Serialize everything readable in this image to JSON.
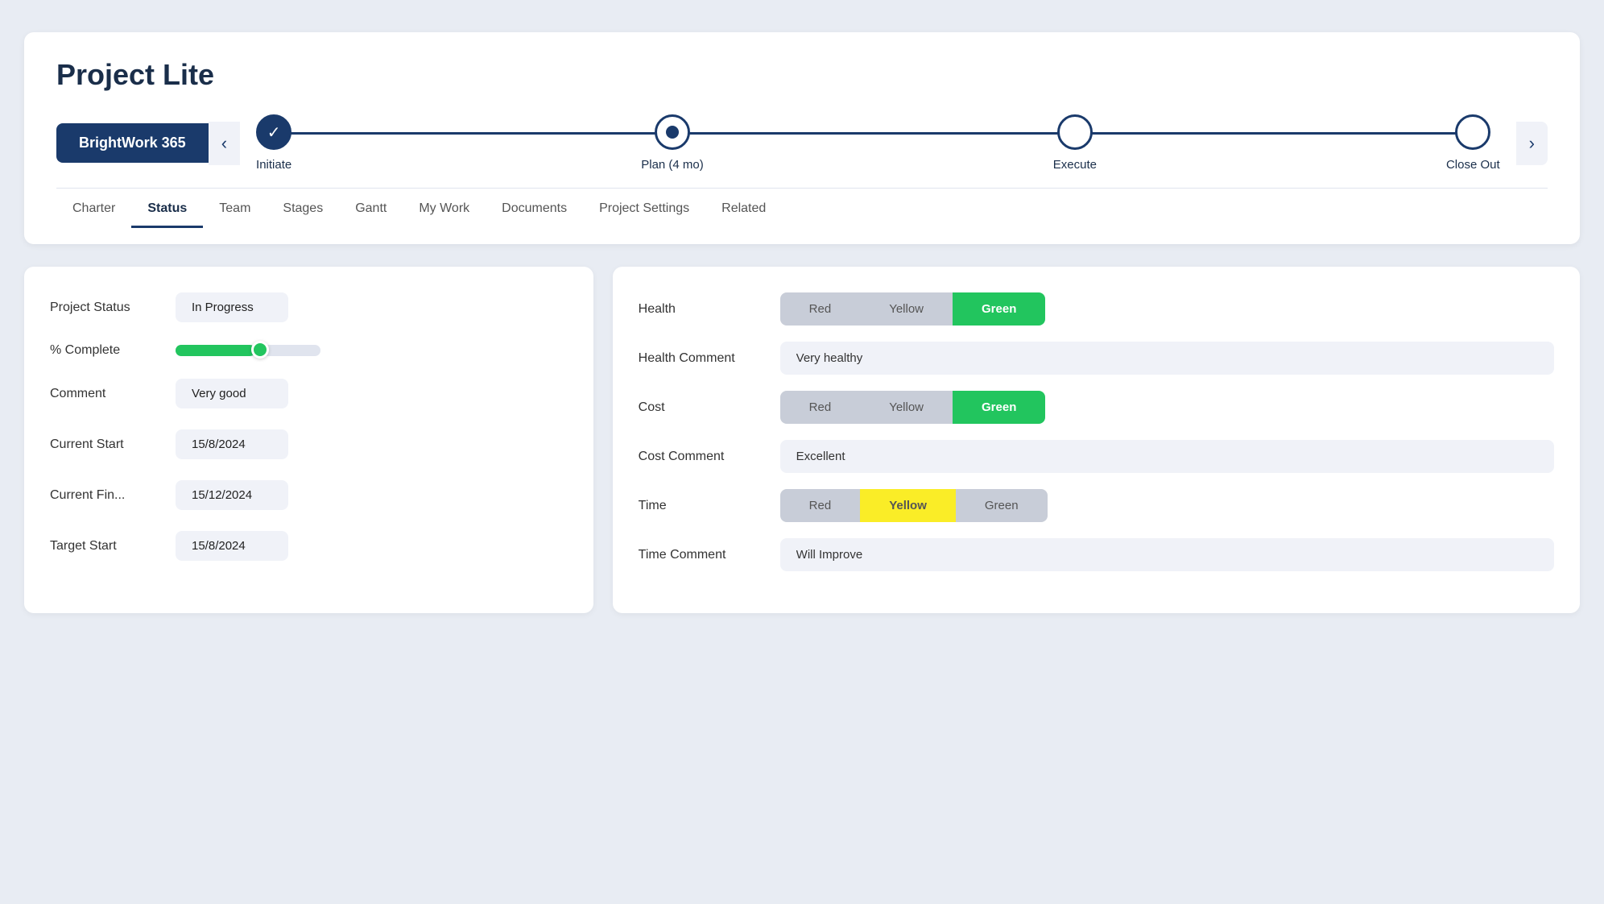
{
  "app": {
    "title": "Project Lite",
    "brand": "BrightWork 365"
  },
  "stages": [
    {
      "id": "initiate",
      "label": "Initiate",
      "state": "completed"
    },
    {
      "id": "plan",
      "label": "Plan (4 mo)",
      "state": "active"
    },
    {
      "id": "execute",
      "label": "Execute",
      "state": "inactive"
    },
    {
      "id": "closeout",
      "label": "Close Out",
      "state": "inactive"
    }
  ],
  "tabs": [
    {
      "id": "charter",
      "label": "Charter",
      "active": false
    },
    {
      "id": "status",
      "label": "Status",
      "active": true
    },
    {
      "id": "team",
      "label": "Team",
      "active": false
    },
    {
      "id": "stages",
      "label": "Stages",
      "active": false
    },
    {
      "id": "gantt",
      "label": "Gantt",
      "active": false
    },
    {
      "id": "mywork",
      "label": "My Work",
      "active": false
    },
    {
      "id": "documents",
      "label": "Documents",
      "active": false
    },
    {
      "id": "projectsettings",
      "label": "Project Settings",
      "active": false
    },
    {
      "id": "related",
      "label": "Related",
      "active": false
    }
  ],
  "left_panel": {
    "fields": [
      {
        "label": "Project Status",
        "value": "In Progress",
        "type": "badge"
      },
      {
        "label": "% Complete",
        "value": "",
        "type": "progress",
        "progress": 55
      },
      {
        "label": "Comment",
        "value": "Very good",
        "type": "badge"
      },
      {
        "label": "Current Start",
        "value": "15/8/2024",
        "type": "text"
      },
      {
        "label": "Current Fin...",
        "value": "15/12/2024",
        "type": "text"
      },
      {
        "label": "Target Start",
        "value": "15/8/2024",
        "type": "text"
      }
    ]
  },
  "right_panel": {
    "rows": [
      {
        "label": "Health",
        "type": "toggle",
        "options": [
          "Red",
          "Yellow",
          "Green"
        ],
        "selected": "Green"
      },
      {
        "label": "Health Comment",
        "type": "comment",
        "value": "Very healthy"
      },
      {
        "label": "Cost",
        "type": "toggle",
        "options": [
          "Red",
          "Yellow",
          "Green"
        ],
        "selected": "Green"
      },
      {
        "label": "Cost Comment",
        "type": "comment",
        "value": "Excellent"
      },
      {
        "label": "Time",
        "type": "toggle",
        "options": [
          "Red",
          "Yellow",
          "Green"
        ],
        "selected": "Yellow"
      },
      {
        "label": "Time Comment",
        "type": "comment",
        "value": "Will Improve"
      }
    ]
  }
}
